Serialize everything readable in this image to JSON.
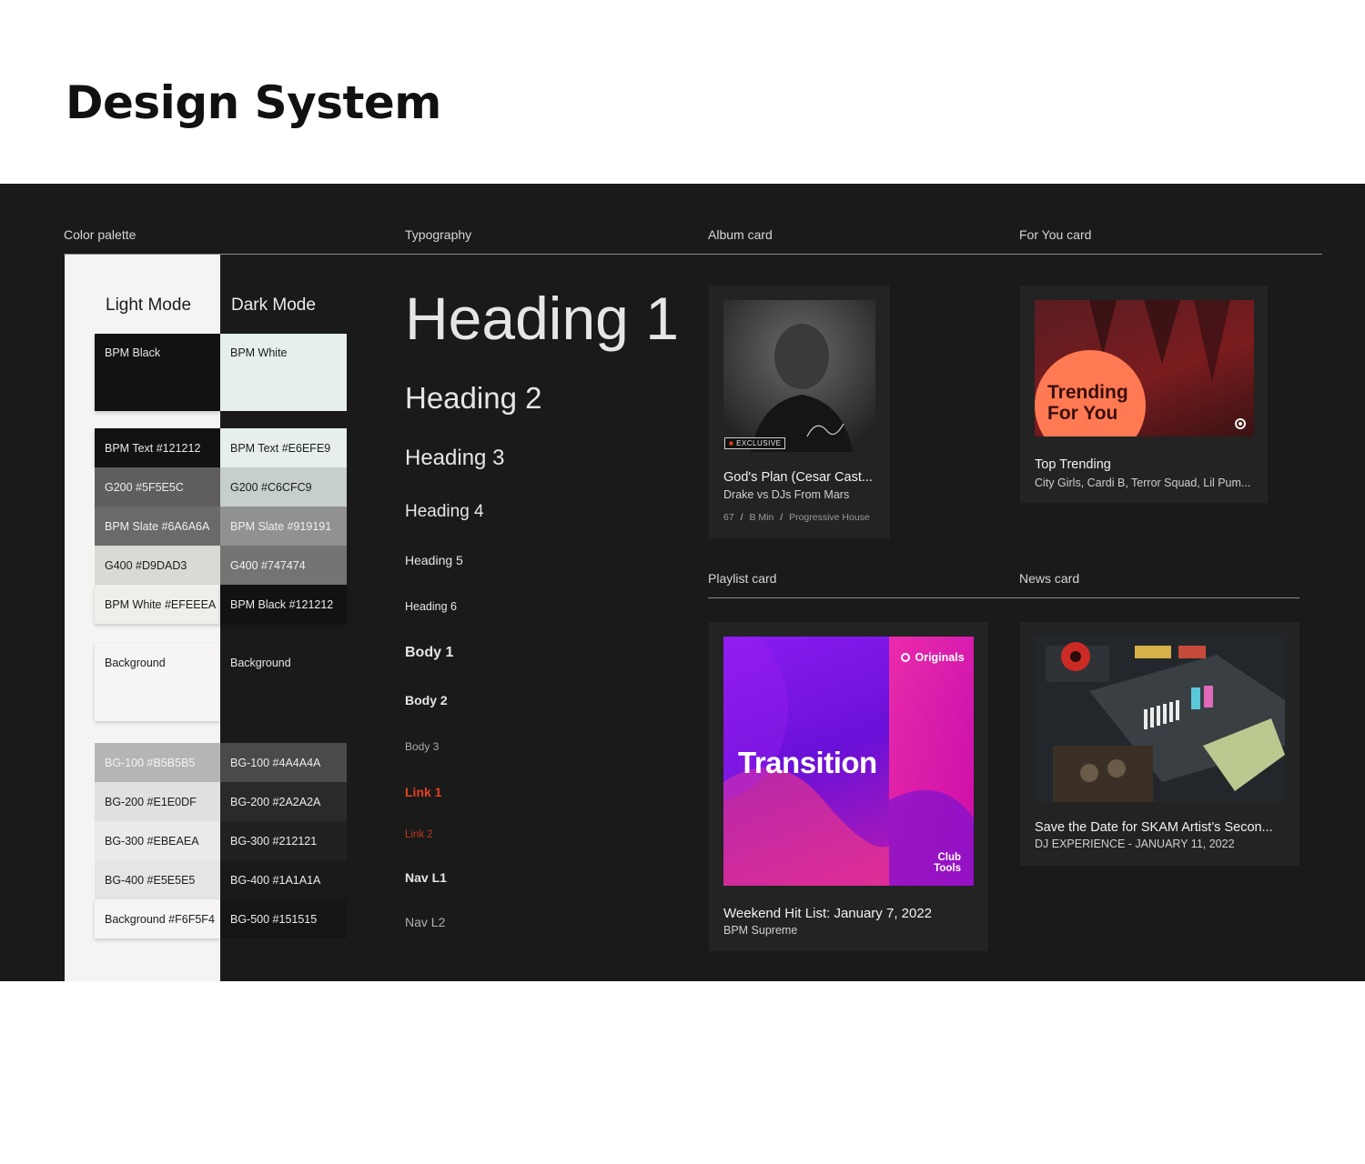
{
  "page": {
    "title": "Design System"
  },
  "sections": {
    "color_palette": "Color palette",
    "typography": "Typography",
    "album_card": "Album card",
    "for_you_card": "For You card",
    "playlist_card": "Playlist card",
    "news_card": "News card"
  },
  "palette": {
    "light_title": "Light Mode",
    "dark_title": "Dark Mode",
    "light": [
      "BPM Black",
      "BPM Text  #121212",
      "G200 #5F5E5C",
      "BPM Slate #6A6A6A",
      "G400 #D9DAD3",
      "BPM White #EFEEEA",
      "Background",
      "BG-100 #B5B5B5",
      "BG-200 #E1E0DF",
      "BG-300 #EBEAEA",
      "BG-400 #E5E5E5",
      "Background #F6F5F4"
    ],
    "dark": [
      "BPM White",
      "BPM Text #E6EFE9",
      "G200 #C6CFC9",
      "BPM Slate #919191",
      "G400 #747474",
      "BPM Black #121212",
      "Background",
      "BG-100 #4A4A4A",
      "BG-200 #2A2A2A",
      "BG-300 #212121",
      "BG-400 #1A1A1A",
      "BG-500 #151515"
    ]
  },
  "typography": {
    "h1": "Heading 1",
    "h2": "Heading 2",
    "h3": "Heading 3",
    "h4": "Heading 4",
    "h5": "Heading 5",
    "h6": "Heading 6",
    "body1": "Body 1",
    "body2": "Body 2",
    "body3": "Body 3",
    "link1": "Link 1",
    "link2": "Link 2",
    "nav1": "Nav L1",
    "nav2": "Nav L2"
  },
  "album": {
    "badge": "EXCLUSIVE",
    "title": "God's Plan (Cesar Cast...",
    "artist": "Drake vs DJs From Mars",
    "meta_bpm": "67",
    "meta_key": "B Min",
    "meta_genre": "Progressive House"
  },
  "for_you": {
    "art_line1": "Trending",
    "art_line2": "For You",
    "title": "Top Trending",
    "artists": "City Girls, Cardi B, Terror Squad, Lil Pum..."
  },
  "playlist": {
    "art_brand": "Originals",
    "art_title": "Transition",
    "art_footer1": "Club",
    "art_footer2": "Tools",
    "title": "Weekend Hit List: January 7, 2022",
    "curator": "BPM Supreme"
  },
  "news": {
    "title": "Save the Date for SKAM Artist’s Secon...",
    "subtitle": "DJ EXPERIENCE - JANUARY 11, 2022"
  },
  "colors": {
    "accent": "#e5401e",
    "board": "#1a1a1a",
    "card": "#232323",
    "light_bg": "#f4f4f2"
  }
}
